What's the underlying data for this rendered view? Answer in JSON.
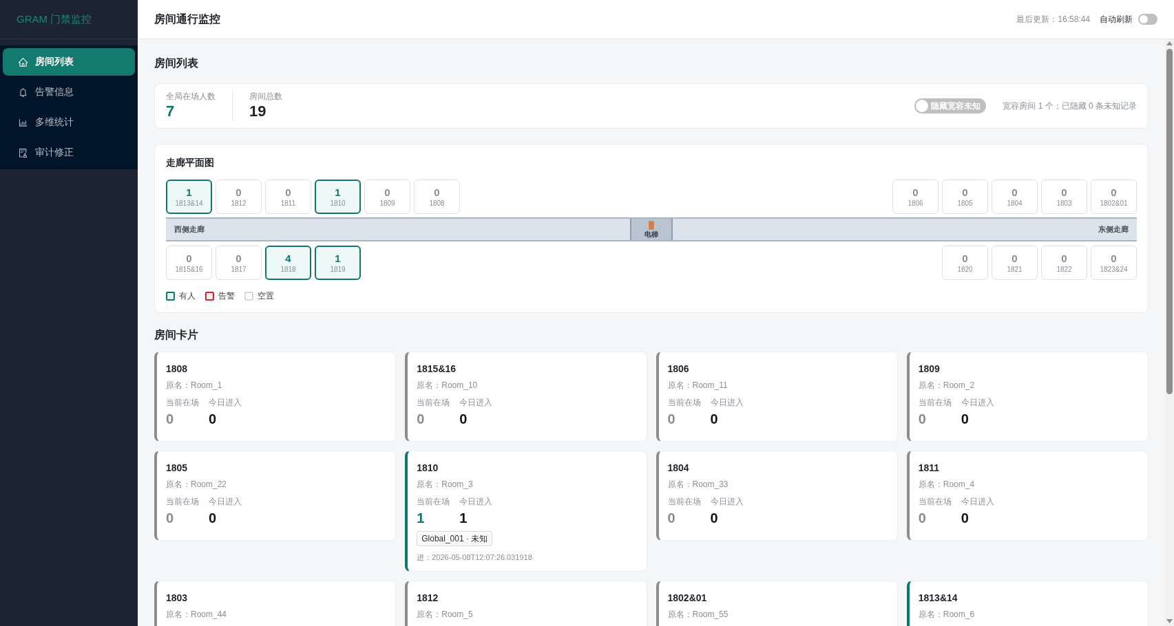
{
  "sidebar": {
    "logo": "GRAM 门禁监控",
    "items": [
      {
        "label": "房间列表",
        "selected": true
      },
      {
        "label": "告警信息",
        "selected": false
      },
      {
        "label": "多维统计",
        "selected": false
      },
      {
        "label": "审计修正",
        "selected": false
      }
    ]
  },
  "header": {
    "title": "房间通行监控",
    "last_updated": "最后更新：16:58:44",
    "auto_refresh": {
      "label": "自动刷新",
      "on": false
    }
  },
  "page": {
    "title": "房间列表"
  },
  "summary": {
    "stats": [
      {
        "label": "全局在场人数",
        "value": "7",
        "kind": "accent"
      },
      {
        "label": "房间总数",
        "value": "19",
        "kind": "plain"
      }
    ],
    "hide_toggle": {
      "label": "隐藏宽容未知",
      "on": false
    },
    "note": "宽容房间 1 个；已隐藏 0 条未知记录"
  },
  "floor_plan": {
    "title": "走廊平面图",
    "top_west": [
      {
        "count": "1",
        "room": "1813&14",
        "occupied": true
      },
      {
        "count": "0",
        "room": "1812",
        "occupied": false
      },
      {
        "count": "0",
        "room": "1811",
        "occupied": false
      },
      {
        "count": "1",
        "room": "1810",
        "occupied": true
      },
      {
        "count": "0",
        "room": "1809",
        "occupied": false
      },
      {
        "count": "0",
        "room": "1808",
        "occupied": false
      }
    ],
    "top_east": [
      {
        "count": "0",
        "room": "1806",
        "occupied": false
      },
      {
        "count": "0",
        "room": "1805",
        "occupied": false
      },
      {
        "count": "0",
        "room": "1804",
        "occupied": false
      },
      {
        "count": "0",
        "room": "1803",
        "occupied": false
      },
      {
        "count": "0",
        "room": "1802&01",
        "occupied": false
      }
    ],
    "corridor": {
      "west_label": "西侧走廊",
      "elevator_label": "电梯",
      "east_label": "东侧走廊"
    },
    "bottom_west": [
      {
        "count": "0",
        "room": "1815&16",
        "occupied": false
      },
      {
        "count": "0",
        "room": "1817",
        "occupied": false
      },
      {
        "count": "4",
        "room": "1818",
        "occupied": true
      },
      {
        "count": "1",
        "room": "1819",
        "occupied": true
      }
    ],
    "bottom_east": [
      {
        "count": "0",
        "room": "1820",
        "occupied": false
      },
      {
        "count": "0",
        "room": "1821",
        "occupied": false
      },
      {
        "count": "0",
        "room": "1822",
        "occupied": false
      },
      {
        "count": "0",
        "room": "1823&24",
        "occupied": false
      }
    ],
    "legend": [
      {
        "label": "有人",
        "color": "#0f766e"
      },
      {
        "label": "告警",
        "color": "#cc2b2b"
      },
      {
        "label": "空置",
        "color": "#d6d8dc"
      }
    ]
  },
  "cards_section": {
    "title": "房间卡片",
    "cards": [
      {
        "name": "1808",
        "origin": "原名：Room_1",
        "occupied": false,
        "current_label": "当前在场",
        "current": "0",
        "today_label": "今日进入",
        "today": "0"
      },
      {
        "name": "1815&16",
        "origin": "原名：Room_10",
        "occupied": false,
        "current_label": "当前在场",
        "current": "0",
        "today_label": "今日进入",
        "today": "0"
      },
      {
        "name": "1806",
        "origin": "原名：Room_11",
        "occupied": false,
        "current_label": "当前在场",
        "current": "0",
        "today_label": "今日进入",
        "today": "0"
      },
      {
        "name": "1809",
        "origin": "原名：Room_2",
        "occupied": false,
        "current_label": "当前在场",
        "current": "0",
        "today_label": "今日进入",
        "today": "0"
      },
      {
        "name": "1805",
        "origin": "原名：Room_22",
        "occupied": false,
        "current_label": "当前在场",
        "current": "0",
        "today_label": "今日进入",
        "today": "0"
      },
      {
        "name": "1810",
        "origin": "原名：Room_3",
        "occupied": true,
        "current_label": "当前在场",
        "current": "1",
        "today_label": "今日进入",
        "today": "1",
        "tags": [
          "Global_001 · 未知"
        ],
        "entry": "进：2026-05-08T12:07:26.031918"
      },
      {
        "name": "1804",
        "origin": "原名：Room_33",
        "occupied": false,
        "current_label": "当前在场",
        "current": "0",
        "today_label": "今日进入",
        "today": "0"
      },
      {
        "name": "1811",
        "origin": "原名：Room_4",
        "occupied": false,
        "current_label": "当前在场",
        "current": "0",
        "today_label": "今日进入",
        "today": "0"
      },
      {
        "name": "1803",
        "origin": "原名：Room_44",
        "occupied": false
      },
      {
        "name": "1812",
        "origin": "原名：Room_5",
        "occupied": false
      },
      {
        "name": "1802&01",
        "origin": "原名：Room_55",
        "occupied": false
      },
      {
        "name": "1813&14",
        "origin": "原名：Room_6",
        "occupied": true
      }
    ]
  }
}
